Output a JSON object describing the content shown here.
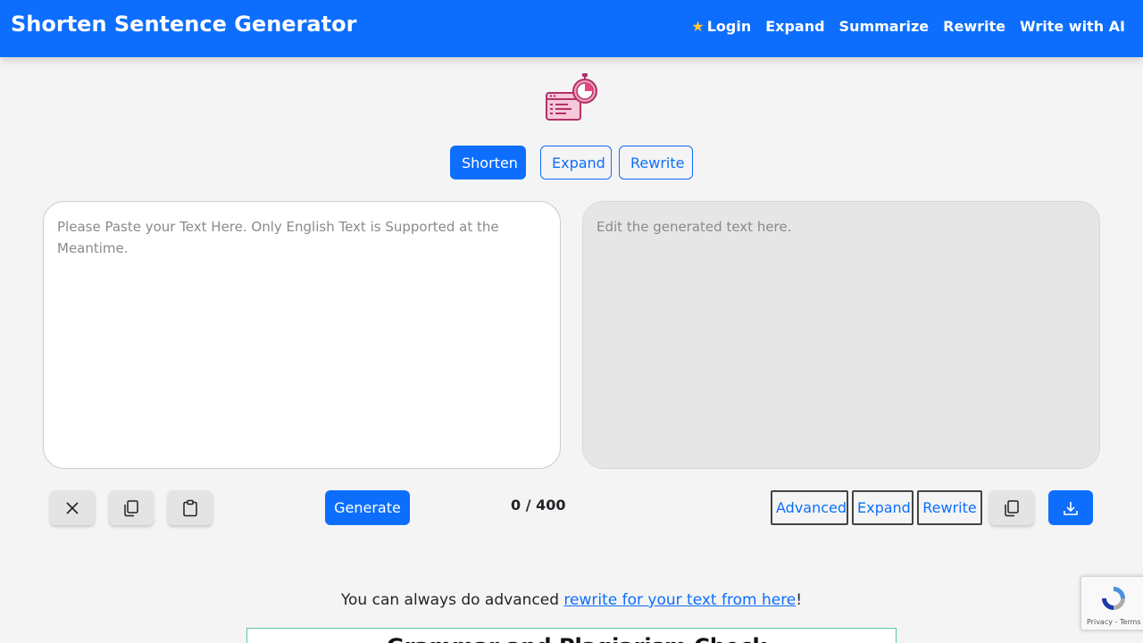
{
  "navbar": {
    "brand": "Shorten Sentence Generator",
    "links": [
      {
        "label": "Login",
        "icon": "star-icon"
      },
      {
        "label": "Expand"
      },
      {
        "label": "Summarize"
      },
      {
        "label": "Rewrite"
      },
      {
        "label": "Write with AI"
      }
    ]
  },
  "modes": {
    "shorten": "Shorten",
    "expand": "Expand",
    "rewrite": "Rewrite",
    "active": "Shorten"
  },
  "input": {
    "placeholder": "Please Paste your Text Here. Only English Text is Supported at the Meantime.",
    "value": ""
  },
  "output": {
    "placeholder": "Edit the generated text here.",
    "value": ""
  },
  "toolbar": {
    "clear_icon": "close-icon",
    "copy_icon": "copy-icon",
    "paste_icon": "clipboard-icon",
    "generate_label": "Generate",
    "counter": "0 / 400",
    "advanced_label": "Advanced",
    "expand_label": "Expand",
    "rewrite_label": "Rewrite",
    "download_icon": "download-icon"
  },
  "footer_note": {
    "prefix": "You can always do advanced ",
    "link": "rewrite for your text from here",
    "suffix": "!"
  },
  "ad": {
    "text": "Grammar and Plagiarism Check"
  },
  "recaptcha": {
    "terms": "Privacy - Terms"
  },
  "colors": {
    "primary": "#0d6efd",
    "background": "#f4f4f4",
    "star": "#ffca28"
  }
}
